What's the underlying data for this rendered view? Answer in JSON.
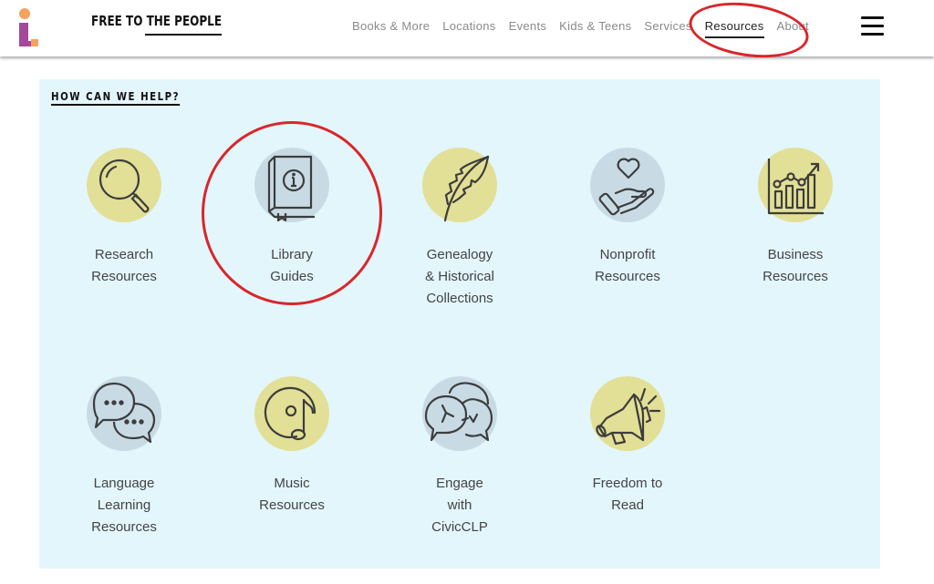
{
  "header": {
    "brand": "FREE TO THE PEOPLE",
    "nav": [
      {
        "label": "Books & More",
        "active": false
      },
      {
        "label": "Locations",
        "active": false
      },
      {
        "label": "Events",
        "active": false
      },
      {
        "label": "Kids & Teens",
        "active": false
      },
      {
        "label": "Services",
        "active": false
      },
      {
        "label": "Resources",
        "active": true
      },
      {
        "label": "About",
        "active": false
      }
    ],
    "menu_icon": "hamburger-menu-icon"
  },
  "panel": {
    "title": "HOW CAN WE HELP?",
    "tiles": [
      {
        "label_lines": [
          "Research",
          "Resources"
        ],
        "icon": "magnifying-glass-icon",
        "color": "yellow"
      },
      {
        "label_lines": [
          "Library",
          "Guides"
        ],
        "icon": "info-book-icon",
        "color": "blue"
      },
      {
        "label_lines": [
          "Genealogy",
          "& Historical",
          "Collections"
        ],
        "icon": "feather-icon",
        "color": "yellow"
      },
      {
        "label_lines": [
          "Nonprofit",
          "Resources"
        ],
        "icon": "heart-hand-icon",
        "color": "blue"
      },
      {
        "label_lines": [
          "Business",
          "Resources"
        ],
        "icon": "growth-chart-icon",
        "color": "yellow"
      },
      {
        "label_lines": [
          "Language",
          "Learning",
          "Resources"
        ],
        "icon": "chat-bubbles-icon",
        "color": "blue"
      },
      {
        "label_lines": [
          "Music",
          "Resources"
        ],
        "icon": "music-disc-icon",
        "color": "yellow"
      },
      {
        "label_lines": [
          "Engage",
          "with",
          "CivicCLP"
        ],
        "icon": "discussion-bubbles-icon",
        "color": "blue"
      },
      {
        "label_lines": [
          "Freedom to",
          "Read"
        ],
        "icon": "megaphone-icon",
        "color": "yellow"
      }
    ]
  },
  "colors": {
    "panel_bg": "#e3f6fc",
    "yellow_circle": "#e2df96",
    "blue_circle": "#c8dbe5",
    "annotation_red": "#d9262b",
    "logo_orange": "#f5a25d",
    "logo_purple": "#a5479b"
  }
}
